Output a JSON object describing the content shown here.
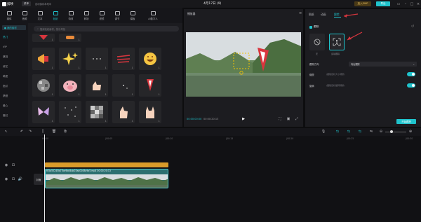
{
  "app": {
    "name": "剪映",
    "menu": "菜单",
    "autosave": "自动保存本地中",
    "project_title": "4月17日 (9)",
    "pro": "加入SVIP",
    "export": "导出"
  },
  "toolbar": {
    "items": [
      "媒体",
      "音频",
      "文本",
      "贴纸",
      "特效",
      "转场",
      "滤镜",
      "调节",
      "模板",
      "AI数字人"
    ],
    "active_index": 3
  },
  "categories": {
    "active": "● 我的素材",
    "items": [
      "热门",
      "VIP",
      "遮挡",
      "综艺",
      "萌宠",
      "指引",
      "搞怪",
      "爱心",
      "魔幻",
      "情绪",
      "电商"
    ]
  },
  "stickers": {
    "search_placeholder": "搜索贴纸素材，快乐寻找"
  },
  "player": {
    "title": "播放器",
    "timecode": "00:00:00:00",
    "total": "00:00:20:13"
  },
  "props": {
    "tabs": [
      "贴纸",
      "动画",
      "跟踪"
    ],
    "active_tab": "跟踪",
    "section": "跟踪",
    "modes": [
      "无",
      "运动跟踪"
    ],
    "direction_label": "跟踪方向",
    "direction_value": "向后跟踪",
    "scale_label": "缩放",
    "scale_desc": "(跟随目标大小调整)",
    "rotate_label": "旋转",
    "rotate_desc": "(跟随目标旋转调整)",
    "start_button": "开始跟踪"
  },
  "timeline": {
    "ticks": [
      "00:00",
      "|00:05",
      "|00:10",
      "|00:15",
      "|00:20",
      "|00:25",
      "|00:30",
      "|00:35",
      "|00:40"
    ],
    "cover": "封面",
    "clip_name": "f05a55245b07be9bd4ab03aa0168c9a5.mp4   00:00:20:13"
  },
  "colors": {
    "accent": "#1fc3cc",
    "effect_clip": "#d99b2a",
    "video_clip": "#2c6f70"
  }
}
